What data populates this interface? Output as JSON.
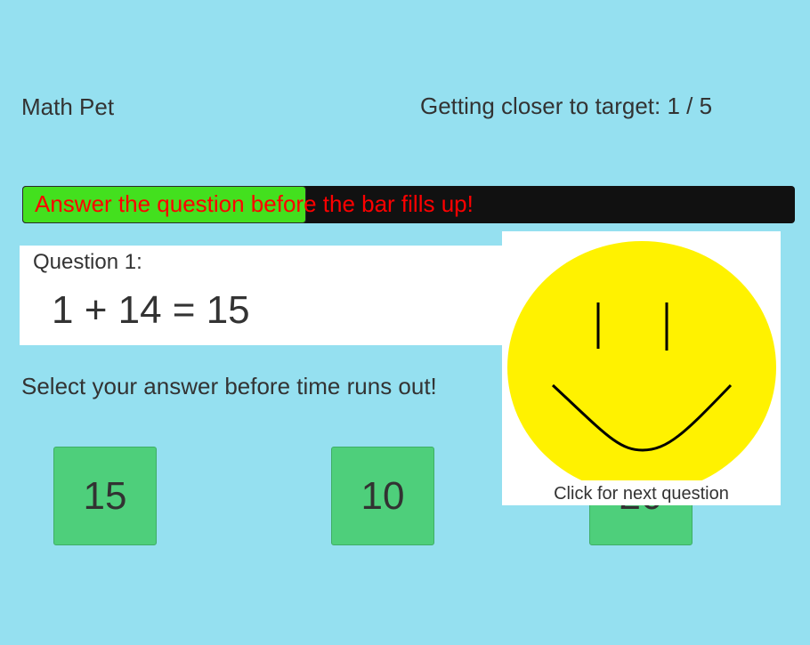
{
  "header": {
    "title": "Math Pet",
    "progress_text": "Getting closer to target: 1 / 5"
  },
  "timer": {
    "label": "Answer the question before the bar fills up!",
    "fill_fraction": 0.367,
    "fill_color": "#43E01E",
    "track_color": "#111111",
    "label_color": "#FF0000"
  },
  "question": {
    "label": "Question 1:",
    "expression": "1 + 14 = 15"
  },
  "instruction": "Select your answer before time runs out!",
  "answers": [
    "15",
    "10",
    "20"
  ],
  "pet": {
    "face_icon": "smiley-face-icon",
    "face_color": "#FFF200",
    "caption": "Click for next question"
  },
  "colors": {
    "background": "#95E0F0",
    "answer_button": "#4ECF7B"
  }
}
